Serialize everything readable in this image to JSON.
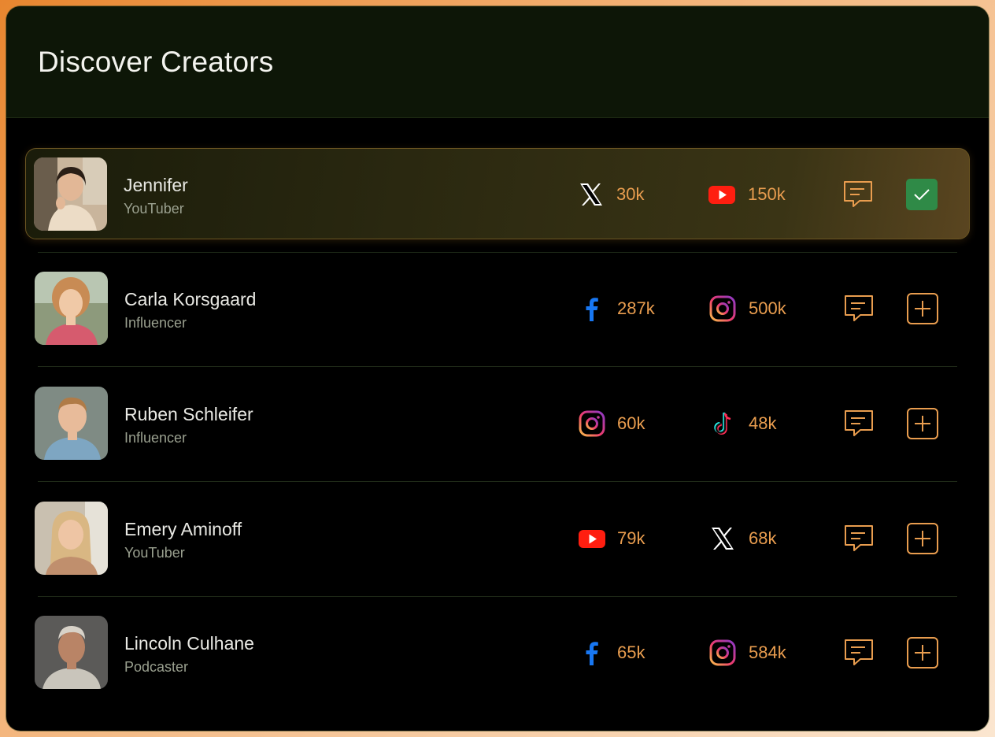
{
  "header": {
    "title": "Discover Creators"
  },
  "creators": [
    {
      "name": "Jennifer",
      "role": "YouTuber",
      "stat1": {
        "platform": "x-icon",
        "count": "30k"
      },
      "stat2": {
        "platform": "youtube-icon",
        "count": "150k"
      },
      "added": true
    },
    {
      "name": "Carla Korsgaard",
      "role": "Influencer",
      "stat1": {
        "platform": "facebook-icon",
        "count": "287k"
      },
      "stat2": {
        "platform": "instagram-icon",
        "count": "500k"
      },
      "added": false
    },
    {
      "name": "Ruben Schleifer",
      "role": "Influencer",
      "stat1": {
        "platform": "instagram-icon",
        "count": "60k"
      },
      "stat2": {
        "platform": "tiktok-icon",
        "count": "48k"
      },
      "added": false
    },
    {
      "name": "Emery Aminoff",
      "role": "YouTuber",
      "stat1": {
        "platform": "youtube-icon",
        "count": "79k"
      },
      "stat2": {
        "platform": "x-icon",
        "count": "68k"
      },
      "added": false
    },
    {
      "name": "Lincoln Culhane",
      "role": "Podcaster",
      "stat1": {
        "platform": "facebook-icon",
        "count": "65k"
      },
      "stat2": {
        "platform": "instagram-icon",
        "count": "584k"
      },
      "added": false
    }
  ],
  "colors": {
    "accent": "#e99d4f",
    "added_green": "#2f8a47",
    "header_bg": "#0d1607"
  }
}
